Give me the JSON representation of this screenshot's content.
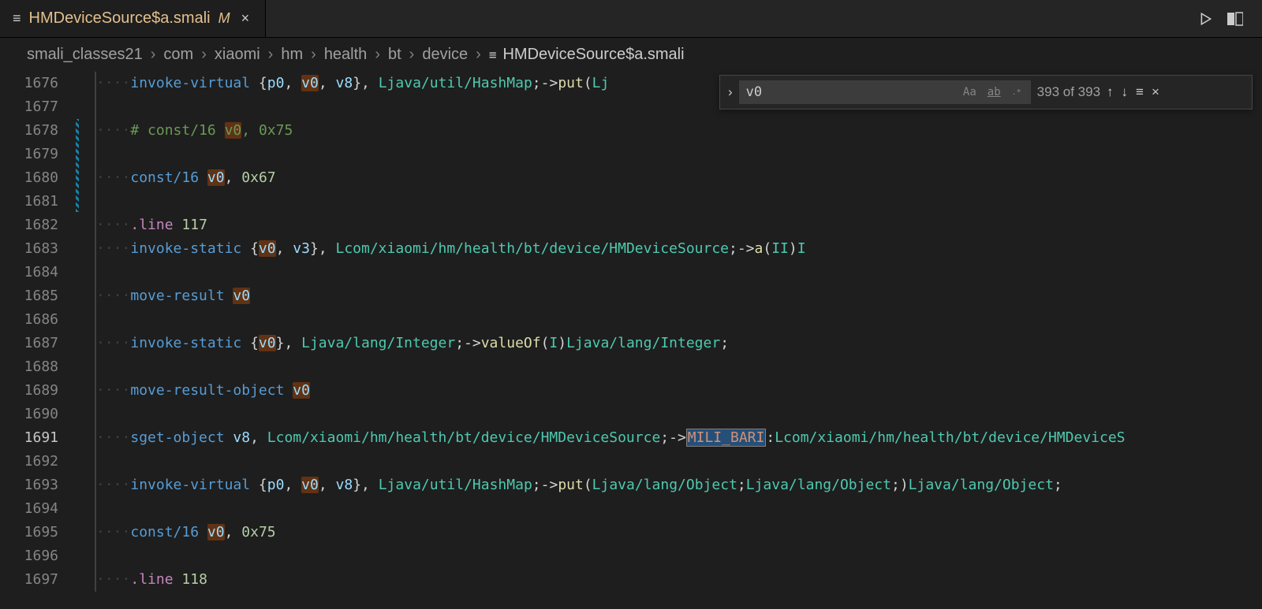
{
  "tab": {
    "filename": "HMDeviceSource$a.smali",
    "modified_badge": "M",
    "close": "×"
  },
  "breadcrumbs": {
    "sep": "›",
    "items": [
      "smali_classes21",
      "com",
      "xiaomi",
      "hm",
      "health",
      "bt",
      "device"
    ],
    "file": "HMDeviceSource$a.smali"
  },
  "find": {
    "query": "v0",
    "case_sensitive_label": "Aa",
    "whole_word_label": "ab",
    "regex_label": ".*",
    "count": "393 of 393",
    "prev": "↑",
    "next": "↓",
    "selection": "≡",
    "close": "×",
    "expand": "›"
  },
  "gutter": {
    "start": 1676,
    "end": 1697,
    "highlight": 1691
  },
  "lines": [
    {
      "n": 1676,
      "t": "code",
      "leading": 1,
      "tokens": [
        [
          "opcode",
          "invoke-virtual "
        ],
        [
          "op",
          "{"
        ],
        [
          "reg",
          "p0"
        ],
        [
          "op",
          ", "
        ],
        [
          "reg hl",
          "v0"
        ],
        [
          "op",
          ", "
        ],
        [
          "reg",
          "v8"
        ],
        [
          "op",
          "}, "
        ],
        [
          "type",
          "Ljava/util/HashMap"
        ],
        [
          "op",
          ";->"
        ],
        [
          "func",
          "put"
        ],
        [
          "op",
          "("
        ],
        [
          "type",
          "Lj"
        ]
      ]
    },
    {
      "n": 1677,
      "t": "blank"
    },
    {
      "n": 1678,
      "t": "comment",
      "leading": 1,
      "tokens": [
        [
          "cmt",
          "# const/16 "
        ],
        [
          "cmt hl",
          "v0"
        ],
        [
          "cmt",
          ", 0x75"
        ]
      ]
    },
    {
      "n": 1679,
      "t": "blank"
    },
    {
      "n": 1680,
      "t": "code",
      "leading": 1,
      "tokens": [
        [
          "opcode",
          "const/16 "
        ],
        [
          "reg hl",
          "v0"
        ],
        [
          "op",
          ", "
        ],
        [
          "num",
          "0x67"
        ]
      ]
    },
    {
      "n": 1681,
      "t": "blank"
    },
    {
      "n": 1682,
      "t": "code",
      "leading": 1,
      "tokens": [
        [
          "kw",
          ".line "
        ],
        [
          "num",
          "117"
        ]
      ]
    },
    {
      "n": 1683,
      "t": "code",
      "leading": 1,
      "tokens": [
        [
          "opcode",
          "invoke-static "
        ],
        [
          "op",
          "{"
        ],
        [
          "reg hl",
          "v0"
        ],
        [
          "op",
          ", "
        ],
        [
          "reg",
          "v3"
        ],
        [
          "op",
          "}, "
        ],
        [
          "type",
          "Lcom/xiaomi/hm/health/bt/device/HMDeviceSource"
        ],
        [
          "op",
          ";->"
        ],
        [
          "func",
          "a"
        ],
        [
          "op",
          "("
        ],
        [
          "type",
          "II"
        ],
        [
          "op",
          ")"
        ],
        [
          "type",
          "I"
        ]
      ]
    },
    {
      "n": 1684,
      "t": "blank"
    },
    {
      "n": 1685,
      "t": "code",
      "leading": 1,
      "tokens": [
        [
          "opcode",
          "move-result "
        ],
        [
          "reg hl",
          "v0"
        ]
      ]
    },
    {
      "n": 1686,
      "t": "blank"
    },
    {
      "n": 1687,
      "t": "code",
      "leading": 1,
      "tokens": [
        [
          "opcode",
          "invoke-static "
        ],
        [
          "op",
          "{"
        ],
        [
          "reg hl",
          "v0"
        ],
        [
          "op",
          "}, "
        ],
        [
          "type",
          "Ljava/lang/Integer"
        ],
        [
          "op",
          ";->"
        ],
        [
          "func",
          "valueOf"
        ],
        [
          "op",
          "("
        ],
        [
          "type",
          "I"
        ],
        [
          "op",
          ")"
        ],
        [
          "type",
          "Ljava/lang/Integer"
        ],
        [
          "op",
          ";"
        ]
      ]
    },
    {
      "n": 1688,
      "t": "blank"
    },
    {
      "n": 1689,
      "t": "code",
      "leading": 1,
      "tokens": [
        [
          "opcode",
          "move-result-object "
        ],
        [
          "reg hl",
          "v0"
        ]
      ]
    },
    {
      "n": 1690,
      "t": "blank"
    },
    {
      "n": 1691,
      "t": "code",
      "leading": 1,
      "tokens": [
        [
          "opcode",
          "sget-object "
        ],
        [
          "reg",
          "v8"
        ],
        [
          "op",
          ", "
        ],
        [
          "type",
          "Lcom/xiaomi/hm/health/bt/device/HMDeviceSource"
        ],
        [
          "op",
          ";->"
        ],
        [
          "sel",
          "MILI_BARI"
        ],
        [
          "op",
          ":"
        ],
        [
          "type",
          "Lcom/xiaomi/hm/health/bt/device/HMDeviceS"
        ]
      ]
    },
    {
      "n": 1692,
      "t": "blank"
    },
    {
      "n": 1693,
      "t": "code",
      "leading": 1,
      "tokens": [
        [
          "opcode",
          "invoke-virtual "
        ],
        [
          "op",
          "{"
        ],
        [
          "reg",
          "p0"
        ],
        [
          "op",
          ", "
        ],
        [
          "reg hl",
          "v0"
        ],
        [
          "op",
          ", "
        ],
        [
          "reg",
          "v8"
        ],
        [
          "op",
          "}, "
        ],
        [
          "type",
          "Ljava/util/HashMap"
        ],
        [
          "op",
          ";->"
        ],
        [
          "func",
          "put"
        ],
        [
          "op",
          "("
        ],
        [
          "type",
          "Ljava/lang/Object"
        ],
        [
          "op",
          ";"
        ],
        [
          "type",
          "Ljava/lang/Object"
        ],
        [
          "op",
          ";)"
        ],
        [
          "type",
          "Ljava/lang/Object"
        ],
        [
          "op",
          ";"
        ]
      ]
    },
    {
      "n": 1694,
      "t": "blank"
    },
    {
      "n": 1695,
      "t": "code",
      "leading": 1,
      "tokens": [
        [
          "opcode",
          "const/16 "
        ],
        [
          "reg hl",
          "v0"
        ],
        [
          "op",
          ", "
        ],
        [
          "num",
          "0x75"
        ]
      ]
    },
    {
      "n": 1696,
      "t": "blank"
    },
    {
      "n": 1697,
      "t": "code",
      "leading": 1,
      "tokens": [
        [
          "kw",
          ".line "
        ],
        [
          "num",
          "118"
        ]
      ]
    }
  ]
}
